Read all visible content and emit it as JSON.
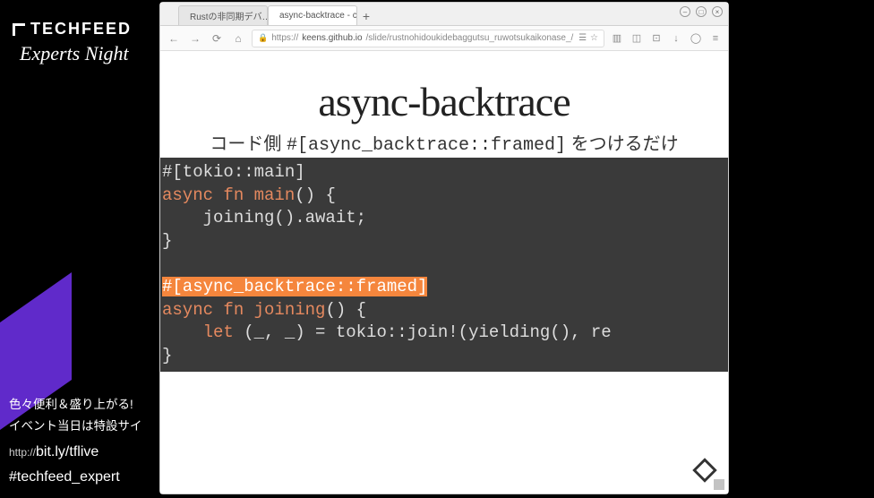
{
  "sidebar": {
    "brand": "TECHFEED",
    "subtitle": "Experts Night",
    "footer": {
      "jp1": "色々便利＆盛り上がる!",
      "jp2": "イベント当日は特設サイ",
      "link_prefix": "http://",
      "link": "bit.ly/tflive",
      "hashtag": "#techfeed_expert"
    }
  },
  "browser": {
    "tabs": [
      {
        "label": "Rustの非同期デバ…"
      },
      {
        "label": "async-backtrace - c"
      }
    ],
    "url": {
      "proto": "https://",
      "host": "keens.github.io",
      "path": "/slide/rustnohidoukidebaggutsu_ruwotsukaikonase_/"
    },
    "window": {
      "min": "–",
      "max": "□",
      "close": "×"
    }
  },
  "slide": {
    "title": "async-backtrace",
    "subtitle_pre": "コード側 ",
    "subtitle_code": "#[async_backtrace::framed]",
    "subtitle_post": " をつけるだけ",
    "code": {
      "l1": "#[tokio::main]",
      "l2a": "async",
      "l2b": " fn ",
      "l2c": "main",
      "l2d": "() {",
      "l3": "    joining().await;",
      "l4": "}",
      "l6": "#[async_backtrace::framed]",
      "l7a": "async",
      "l7b": " fn ",
      "l7c": "joining",
      "l7d": "() {",
      "l8a": "    ",
      "l8b": "let",
      "l8c": " (_, _) = tokio::join!(yielding(), re",
      "l9": "}"
    }
  }
}
